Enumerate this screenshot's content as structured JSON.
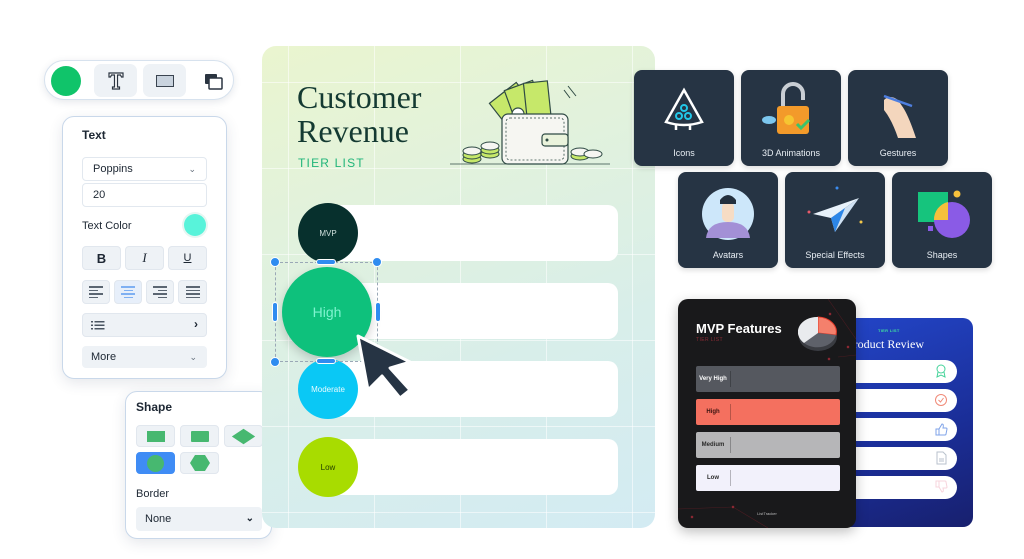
{
  "toolbar": {
    "fill_color": "#10c46a",
    "buttons": [
      {
        "icon": "text-tool-icon"
      },
      {
        "icon": "rectangle-tool-icon"
      },
      {
        "icon": "layers-icon"
      }
    ]
  },
  "text_panel": {
    "title": "Text",
    "font_family": "Poppins",
    "font_size": "20",
    "text_color_label": "Text Color",
    "text_color": "#58f3da",
    "bold": "B",
    "italic": "I",
    "underline": "U",
    "alignments": [
      "left",
      "center",
      "right",
      "justify"
    ],
    "active_alignment": "center",
    "more_label": "More"
  },
  "shape_panel": {
    "title": "Shape",
    "shapes": [
      "rectangle",
      "rounded-rectangle",
      "diamond",
      "circle",
      "hexagon"
    ],
    "active_shape": "circle",
    "border_label": "Border",
    "border_value": "None"
  },
  "tier_card": {
    "title_line1": "Customer",
    "title_line2": "Revenue",
    "subtitle": "TIER LIST",
    "tiers": [
      {
        "label": "MVP",
        "color": "#07302d",
        "text_color": "#cfe0dd"
      },
      {
        "label": "High",
        "color": "#0ec17c",
        "text_color": "#7ff3cf"
      },
      {
        "label": "Moderate",
        "color": "#0ac8f5",
        "text_color": "#e6fbff"
      },
      {
        "label": "Low",
        "color": "#a8dc00",
        "text_color": "#254000"
      }
    ],
    "selected_tier": "High"
  },
  "asset_tiles": [
    {
      "label": "Icons"
    },
    {
      "label": "3D Animations"
    },
    {
      "label": "Gestures"
    },
    {
      "label": "Avatars"
    },
    {
      "label": "Special Effects"
    },
    {
      "label": "Shapes"
    }
  ],
  "mvp_card": {
    "title": "MVP Features",
    "subtitle": "TIER LIST",
    "rows": [
      {
        "label": "Very High",
        "color": "#55585f",
        "text_color": "#ffffff"
      },
      {
        "label": "High",
        "color": "#f4705f",
        "text_color": "#3a1410"
      },
      {
        "label": "Medium",
        "color": "#b6b6b8",
        "text_color": "#2a2a2a"
      },
      {
        "label": "Low",
        "color": "#f2f1fb",
        "text_color": "#2a2a2a"
      }
    ],
    "footer": "ListTracker"
  },
  "review_card": {
    "subtitle": "TIER LIST",
    "title": "Product Review",
    "rows": [
      {
        "icon": "award-icon",
        "color": "#45d39a"
      },
      {
        "icon": "check-circle-icon",
        "color": "#f08a78"
      },
      {
        "icon": "thumbs-up-icon",
        "color": "#7fa3e8"
      },
      {
        "icon": "document-icon",
        "color": "#b9c2cc"
      },
      {
        "icon": "thumbs-down-icon",
        "color": "#f7d4dc"
      }
    ]
  }
}
